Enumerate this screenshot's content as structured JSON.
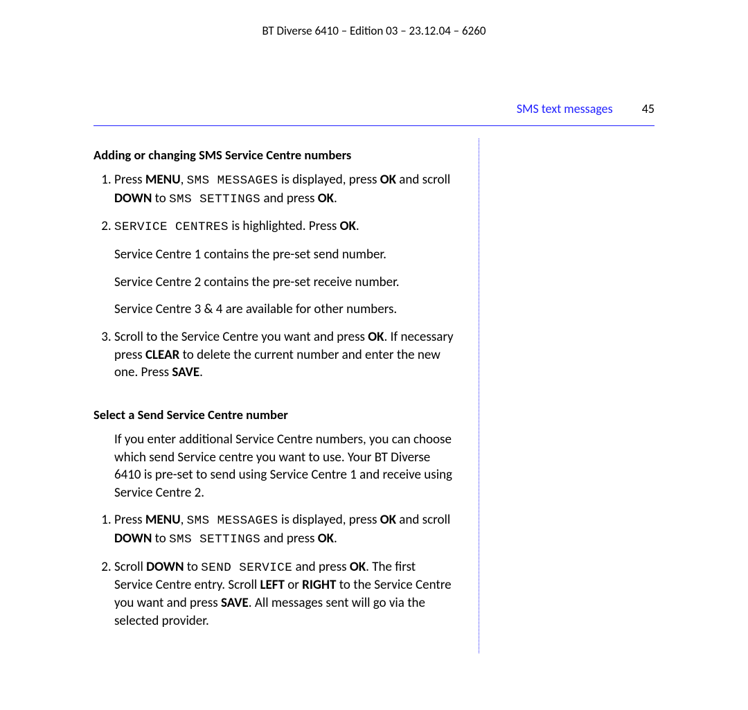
{
  "doc_header": "BT Diverse 6410 – Edition 03 – 23.12.04 – 6260",
  "running_head": {
    "section": "SMS text messages",
    "page": "45"
  },
  "s1": {
    "heading": "Adding or changing SMS Service Centre numbers",
    "li1": {
      "a": "Press ",
      "b": "MENU",
      "c": ", ",
      "d": "SMS MESSAGES",
      "e": " is displayed, press ",
      "f": "OK",
      "g": " and scroll ",
      "h": "DOWN",
      "i": " to ",
      "j": "SMS SETTINGS",
      "k": " and press ",
      "l": "OK",
      "m": "."
    },
    "li2": {
      "a": "SERVICE CENTRES",
      "b": " is highlighted. Press ",
      "c": "OK",
      "d": "."
    },
    "p_a": "Service Centre 1 contains the pre-set send number.",
    "p_b": "Service Centre 2 contains the pre-set receive number.",
    "p_c": "Service Centre 3 & 4 are available for other numbers.",
    "li3": {
      "a": "Scroll to the Service Centre you want and press ",
      "b": "OK",
      "c": ". If necessary press ",
      "d": "CLEAR",
      "e": " to delete the current number and enter the new one. Press ",
      "f": "SAVE",
      "g": "."
    }
  },
  "s2": {
    "heading": "Select a Send Service Centre number",
    "intro": "If you enter additional Service Centre numbers, you can choose which send Service centre you want to use. Your BT Diverse 6410 is pre-set to send using Service Centre 1 and receive using Service Centre 2.",
    "li1": {
      "a": "Press ",
      "b": "MENU",
      "c": ", ",
      "d": "SMS MESSAGES",
      "e": " is displayed, press ",
      "f": "OK",
      "g": " and scroll ",
      "h": "DOWN",
      "i": " to ",
      "j": "SMS SETTINGS",
      "k": " and press ",
      "l": "OK",
      "m": "."
    },
    "li2": {
      "a": "Scroll ",
      "b": "DOWN",
      "c": " to ",
      "d": "SEND SERVICE",
      "e": " and press ",
      "f": "OK",
      "g": ". The first Service Centre entry. Scroll ",
      "h": "LEFT",
      "i": " or ",
      "j": "RIGHT",
      "k": " to the Service Centre you want and press ",
      "l": "SAVE",
      "m": ". All messages sent will go via the selected provider."
    }
  }
}
